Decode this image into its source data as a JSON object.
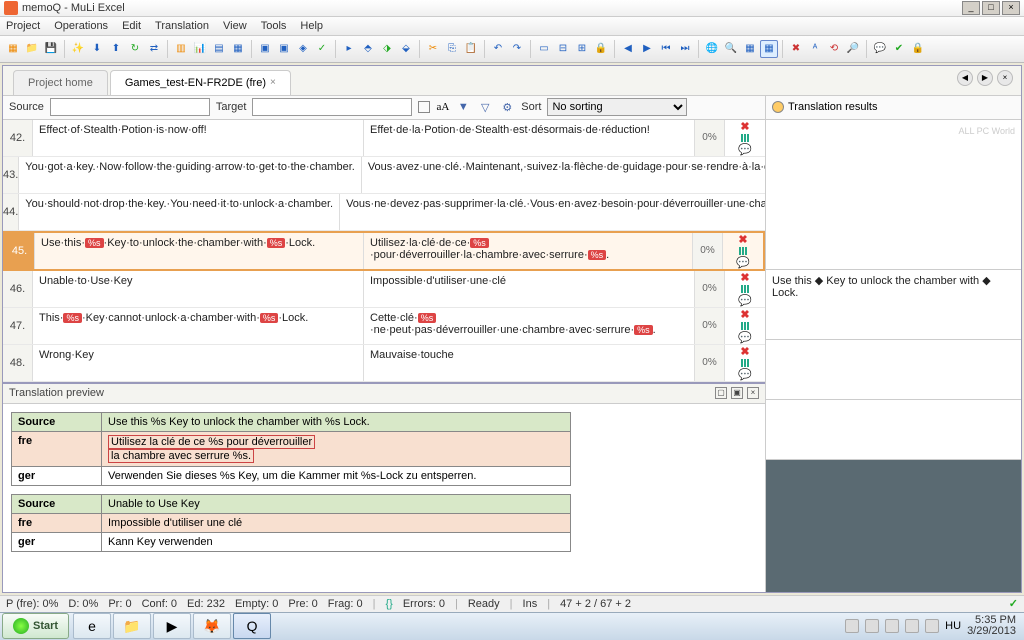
{
  "window": {
    "title": "memoQ - MuLi Excel"
  },
  "menus": [
    "Project",
    "Operations",
    "Edit",
    "Translation",
    "View",
    "Tools",
    "Help"
  ],
  "tabs": {
    "home": "Project home",
    "doc": "Games_test-EN-FR2DE (fre)"
  },
  "filter": {
    "source_label": "Source",
    "target_label": "Target",
    "aa": "aA",
    "sort_label": "Sort",
    "sort_value": "No sorting"
  },
  "rows": [
    {
      "n": "42.",
      "src": "Effect·of·Stealth·Potion·is·now·off!",
      "tgt": "Effet·de·la·Potion·de·Stealth·est·désormais·de·réduction!",
      "pct": "0%"
    },
    {
      "n": "43.",
      "src": "You·got·a·key.·Now·follow·the·guiding·arrow·to·get·to·the·chamber.",
      "tgt": "Vous·avez·une·clé.·Maintenant,·suivez·la·flèche·de·guidage·pour·se·rendre·à·la·chambre.",
      "pct": "0%"
    },
    {
      "n": "44.",
      "src": "You·should·not·drop·the·key.·You·need·it·to·unlock·a·chamber.",
      "tgt": "Vous·ne·devez·pas·supprimer·la·clé.·Vous·en·avez·besoin·pour·déverrouiller·une·chambre.",
      "pct": "0%"
    },
    {
      "n": "45.",
      "src_pre": "Use·this·",
      "src_mid": "·Key·to·unlock·the·chamber·with·",
      "src_post": "·Lock.",
      "tgt_pre": "Utilisez·la·clé·de·ce·",
      "tgt_mid": "·pour·déverrouiller·la·chambre·avec·serrure·",
      "tgt_post": ".",
      "pct": "0%",
      "tag": "%s",
      "sel": true
    },
    {
      "n": "46.",
      "src": "Unable·to·Use·Key",
      "tgt": "Impossible·d'utiliser·une·clé",
      "pct": "0%"
    },
    {
      "n": "47.",
      "src_pre": "This·",
      "src_mid": "·Key·cannot·unlock·a·chamber·with·",
      "src_post": "·Lock.",
      "tgt_pre": "Cette·clé·",
      "tgt_mid": "·ne·peut·pas·déverrouiller·une·chambre·avec·serrure·",
      "tgt_post": ".",
      "pct": "0%",
      "tag": "%s"
    },
    {
      "n": "48.",
      "src": "Wrong·Key",
      "tgt": "Mauvaise·touche",
      "pct": "0%"
    }
  ],
  "preview": {
    "title": "Translation preview",
    "labels": {
      "source": "Source",
      "fre": "fre",
      "ger": "ger"
    },
    "block1": {
      "src": "Use this %s Key to unlock the chamber with %s Lock.",
      "fre1": "Utilisez la clé de ce %s pour déverrouiller",
      "fre2": "la chambre avec serrure %s.",
      "ger": "Verwenden Sie dieses %s Key, um die Kammer mit %s-Lock zu entsperren."
    },
    "block2": {
      "src": "Unable to Use Key",
      "fre": "Impossible d'utiliser une clé",
      "ger": "Kann Key verwenden"
    }
  },
  "results": {
    "title": "Translation results",
    "watermark": "ALL PC World",
    "suggest": "Use this ◆ Key to unlock the chamber with ◆ Lock."
  },
  "status": {
    "p": "P (fre): 0%",
    "d": "D: 0%",
    "pr": "Pr: 0",
    "conf": "Conf: 0",
    "ed": "Ed: 232",
    "empty": "Empty: 0",
    "pre": "Pre: 0",
    "frag": "Frag: 0",
    "err": "Errors: 0",
    "ready": "Ready",
    "ins": "Ins",
    "pos": "47 + 2 / 67 + 2"
  },
  "taskbar": {
    "start": "Start",
    "lang": "HU",
    "time": "5:35 PM",
    "date": "3/29/2013"
  }
}
